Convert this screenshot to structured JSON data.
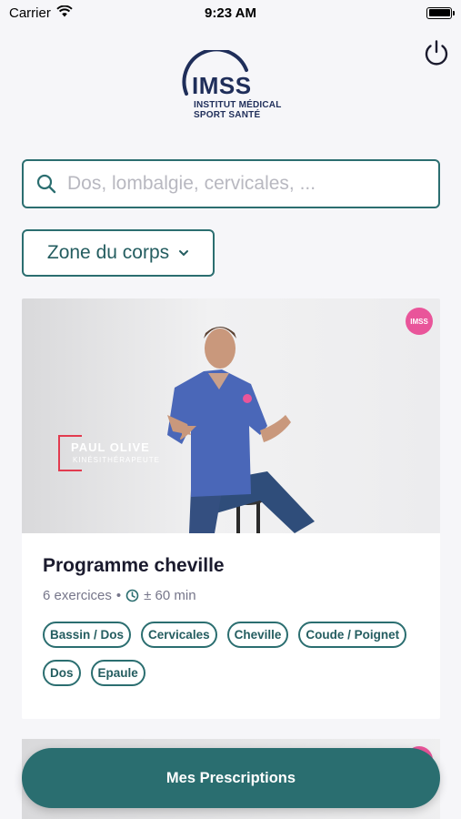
{
  "status_bar": {
    "carrier": "Carrier",
    "time": "9:23 AM"
  },
  "header": {
    "logo_title": "IMSS",
    "logo_line1": "INSTITUT MÉDICAL",
    "logo_line2": "SPORT SANTÉ"
  },
  "search": {
    "placeholder": "Dos, lombalgie, cervicales, ..."
  },
  "filter": {
    "zone_label": "Zone du corps"
  },
  "program_card": {
    "badge": "IMSS",
    "presenter_name": "PAUL OLIVE",
    "presenter_role": "KINÉSITHÉRAPEUTE",
    "title": "Programme cheville",
    "exercises": "6 exercices",
    "separator": "•",
    "duration": "± 60 min",
    "tags": [
      "Bassin / Dos",
      "Cervicales",
      "Cheville",
      "Coude / Poignet",
      "Dos",
      "Epaule"
    ]
  },
  "bottom": {
    "prescriptions_label": "Mes Prescriptions"
  },
  "colors": {
    "accent": "#2a6e70",
    "brand_pink": "#e9559a",
    "logo_navy": "#1f2e5a"
  }
}
